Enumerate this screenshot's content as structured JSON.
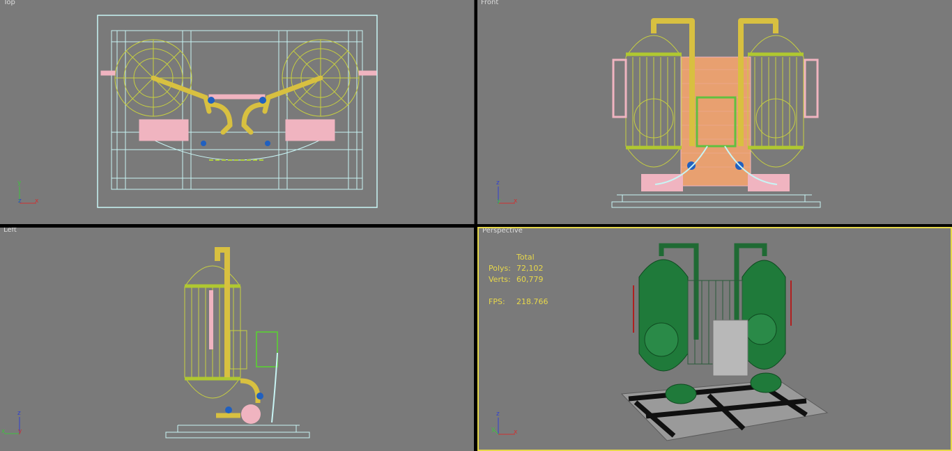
{
  "viewports": {
    "top": {
      "label": "Top",
      "axes": [
        "y",
        "z",
        "x"
      ]
    },
    "front": {
      "label": "Front",
      "axes": [
        "z",
        "y",
        "x"
      ]
    },
    "left": {
      "label": "Left",
      "axes": [
        "z",
        "x",
        "y"
      ]
    },
    "perspective": {
      "label": "Perspective",
      "axes": [
        "z",
        "y",
        "x"
      ],
      "stats": {
        "header": "Total",
        "polys_label": "Polys:",
        "polys_value": "72,102",
        "verts_label": "Verts:",
        "verts_value": "60,779",
        "fps_label": "FPS:",
        "fps_value": "218.766"
      }
    }
  },
  "colors": {
    "viewport_bg": "#7a7a7a",
    "active_border": "#e6d84a",
    "wire_yellow": "#d8c040",
    "wire_green": "#b0c830",
    "wire_pink": "#f0b4c0",
    "wire_cyan": "#c8f4f4",
    "wire_blue": "#2060c0",
    "tank_green": "#1f7a3a",
    "stats_text": "#e8d84a"
  }
}
